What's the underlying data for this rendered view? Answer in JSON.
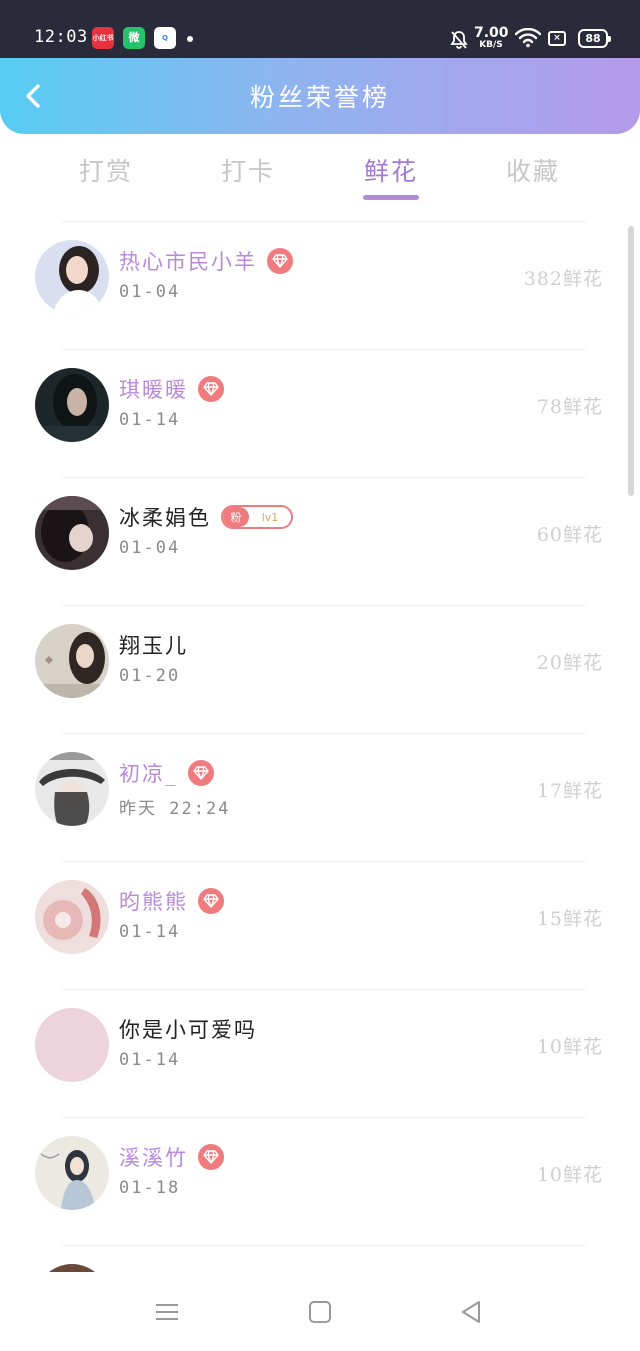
{
  "status_bar": {
    "time": "12:03",
    "app1": "小红书",
    "app2": "微",
    "app3": "Q",
    "speed_value": "7.00",
    "speed_unit": "KB/S",
    "sim_icon": "×",
    "battery": "88"
  },
  "header": {
    "title": "粉丝荣誉榜"
  },
  "tabs": [
    {
      "label": "打赏"
    },
    {
      "label": "打卡"
    },
    {
      "label": "鲜花"
    },
    {
      "label": "收藏"
    }
  ],
  "active_tab": "鲜花",
  "colors": {
    "accent": "#b08ad9",
    "vip_name": "#b88adb",
    "badge": "#ef7b7f"
  },
  "fans": [
    {
      "name": "热心市民小羊",
      "date": "01-04",
      "count": "382鲜花",
      "badge": "diamond"
    },
    {
      "name": "琪暖暖",
      "date": "01-14",
      "count": "78鲜花",
      "badge": "diamond"
    },
    {
      "name": "冰柔娟色",
      "date": "01-04",
      "count": "60鲜花",
      "badge": "fan",
      "fan_label": "粉",
      "fan_level": "lv1"
    },
    {
      "name": "翔玉儿",
      "date": "01-20",
      "count": "20鲜花",
      "badge": "none"
    },
    {
      "name": "初凉_",
      "date": "昨天 22:24",
      "count": "17鲜花",
      "badge": "diamond"
    },
    {
      "name": "昀熊熊",
      "date": "01-14",
      "count": "15鲜花",
      "badge": "diamond"
    },
    {
      "name": "你是小可爱吗",
      "date": "01-14",
      "count": "10鲜花",
      "badge": "none"
    },
    {
      "name": "溪溪竹",
      "date": "01-18",
      "count": "10鲜花",
      "badge": "diamond"
    }
  ]
}
